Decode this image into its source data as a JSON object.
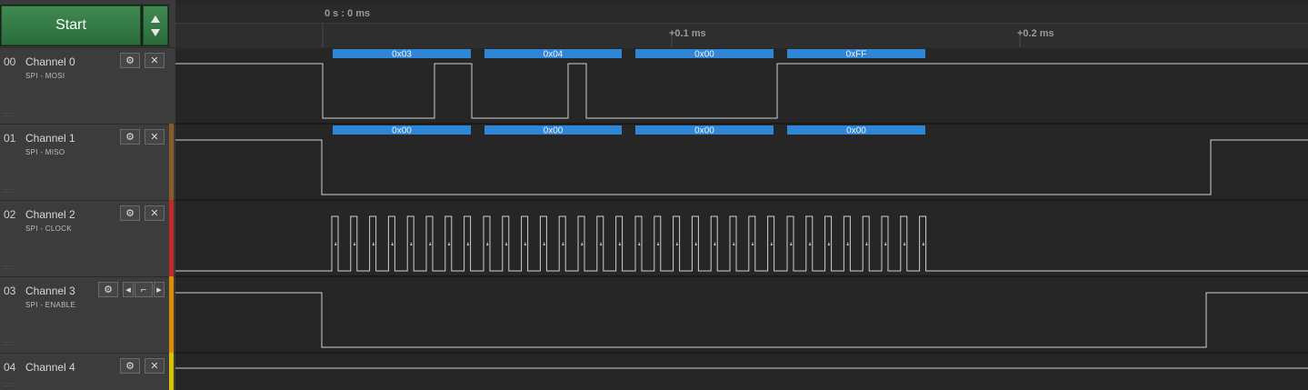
{
  "app": {
    "start_label": "Start"
  },
  "ruler": {
    "origin_label": "0 s : 0 ms",
    "ticks": [
      "+0.1 ms",
      "+0.2 ms"
    ]
  },
  "channels": [
    {
      "index": "00",
      "name": "Channel 0",
      "protocol": "SPI - MOSI",
      "color": "#6a6a6a",
      "decoded": [
        "0x03",
        "0x04",
        "0x00",
        "0xFF"
      ]
    },
    {
      "index": "01",
      "name": "Channel 1",
      "protocol": "SPI - MISO",
      "color": "#8b5a2b",
      "decoded": [
        "0x00",
        "0x00",
        "0x00",
        "0x00"
      ]
    },
    {
      "index": "02",
      "name": "Channel 2",
      "protocol": "SPI - CLOCK",
      "color": "#c62828",
      "decoded": []
    },
    {
      "index": "03",
      "name": "Channel 3",
      "protocol": "SPI - ENABLE",
      "color": "#e08a00",
      "decoded": []
    },
    {
      "index": "04",
      "name": "Channel 4",
      "protocol": "",
      "color": "#d7c400",
      "decoded": []
    }
  ],
  "colors": {
    "accent_green": "#3f8a52",
    "decode_blue": "#2f86d6",
    "trace": "#d0d0d0",
    "background": "#262626"
  },
  "icons": [
    "gear-icon",
    "close-icon",
    "arrow-up-icon",
    "arrow-down-icon",
    "trigger-edge-icon",
    "arrow-left-icon",
    "arrow-right-icon"
  ]
}
